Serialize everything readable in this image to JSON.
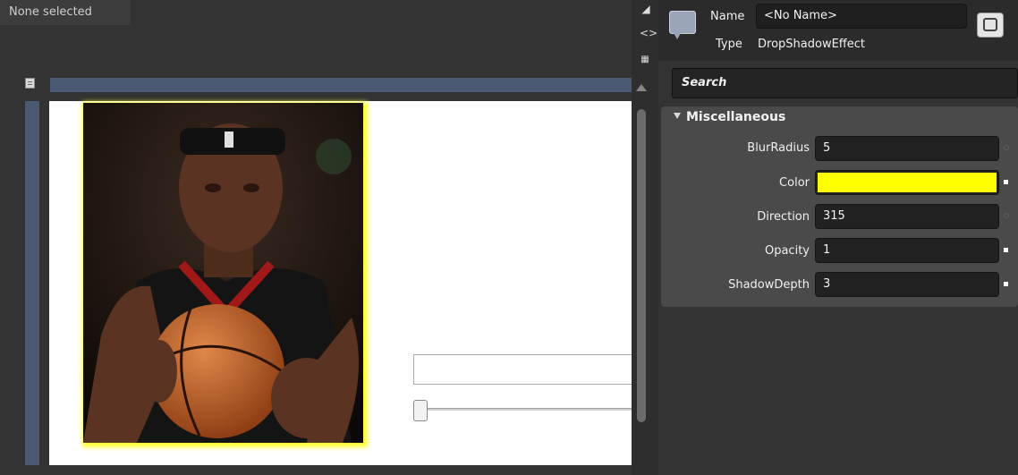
{
  "design": {
    "selection_label": "None selected"
  },
  "properties": {
    "name_label": "Name",
    "name_value": "<No Name>",
    "type_label": "Type",
    "type_value": "DropShadowEffect",
    "search_placeholder": "Search",
    "category": "Miscellaneous",
    "rows": [
      {
        "label": "BlurRadius",
        "value": "5"
      },
      {
        "label": "Color",
        "value": "",
        "color": "#ffff00"
      },
      {
        "label": "Direction",
        "value": "315"
      },
      {
        "label": "Opacity",
        "value": "1"
      },
      {
        "label": "ShadowDepth",
        "value": "3"
      }
    ]
  },
  "colors": {
    "shadow_color": "#ffff00",
    "panel_bg": "#333333",
    "category_bg": "#4a4a4a"
  }
}
